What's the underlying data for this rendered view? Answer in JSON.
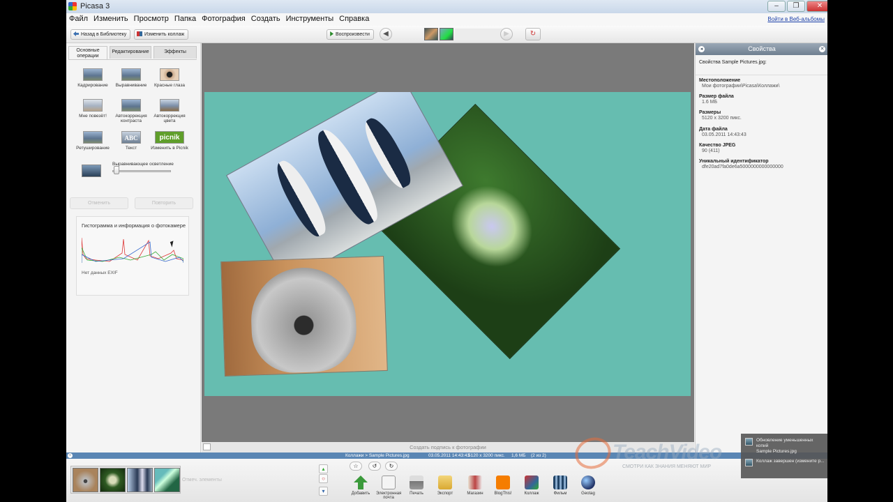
{
  "window": {
    "title": "Picasa 3"
  },
  "menu": {
    "items": [
      "Файл",
      "Изменить",
      "Просмотр",
      "Папка",
      "Фотография",
      "Создать",
      "Инструменты",
      "Справка"
    ],
    "signin": "Войти в Веб-альбомы"
  },
  "toolbar": {
    "back": "Назад в Библиотеку",
    "edit_collage": "Изменить коллаж",
    "play": "Воспроизвести"
  },
  "left_panel": {
    "tabs": [
      "Основные операции",
      "Редактирование",
      "Эффекты"
    ],
    "tools": [
      "Кадрирование",
      "Выравнивание",
      "Красные глаза",
      "Мне повезёт!",
      "Автокоррекция контраста",
      "Автокоррекция цвета",
      "Ретуширование",
      "Текст",
      "Изменить в Picnik"
    ],
    "picnik_logo": "picnik",
    "slider_label": "Выравнивающее осветление",
    "undo": "Отменить",
    "redo": "Повторить",
    "histogram_title": "Гистограмма и информация о фотокамере",
    "no_exif": "Нет данных EXIF"
  },
  "caption_placeholder": "Создать подпись к фотографии",
  "properties": {
    "title": "Свойства",
    "file_label": "Свойства Sample Pictures.jpg:",
    "rows": [
      {
        "key": "Местоположение",
        "value": "Мои фотографии\\Picasa\\Коллажи\\"
      },
      {
        "key": "Размер файла",
        "value": "1.6 МБ"
      },
      {
        "key": "Размеры",
        "value": "5120 x 3200 пикс."
      },
      {
        "key": "Дата файла",
        "value": "03.05.2011 14:43:43"
      },
      {
        "key": "Качество JPEG",
        "value": "90 (411)"
      },
      {
        "key": "Уникальный идентификатор",
        "value": "dfe20ad7fa0de6a5000000000000000"
      }
    ]
  },
  "status": {
    "path": "Коллажи > Sample Pictures.jpg",
    "date": "03.05.2011 14:43:43",
    "size": "5120 x 3200 пикс.",
    "filesize": "1,6 МБ",
    "count": "(2 из 2)"
  },
  "tray": {
    "hint": "Отмеч. элементы",
    "buttons": [
      "Добавить",
      "Электронная почта",
      "Печать",
      "Экспорт",
      "Магазин",
      "BlogThis!",
      "Коллаж",
      "Фильм",
      "Geotag"
    ]
  },
  "watermark": {
    "brand": "TeachVideo",
    "tagline": "СМОТРИ КАК ЗНАНИЯ МЕНЯЮТ МИР"
  },
  "notification": {
    "items": [
      "Обновление уменьшенных копий",
      "Sample Pictures.jpg",
      "Коллаж завершен (измените р..."
    ]
  },
  "colors": {
    "canvas_bg": "#66bdb0",
    "status_bar": "#5a86b4",
    "panel_header": "#7f8fa0"
  }
}
